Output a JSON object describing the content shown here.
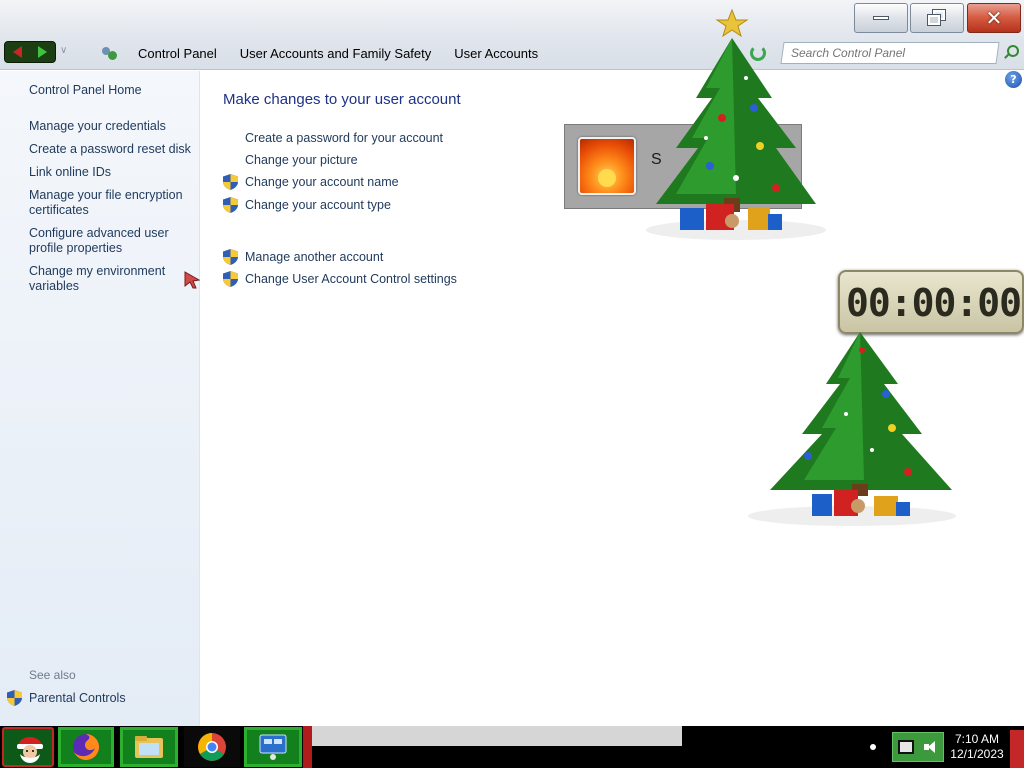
{
  "window": {
    "controls": {
      "minimize": "minimize",
      "maximize": "restore",
      "close": "close"
    }
  },
  "nav": {
    "breadcrumb": [
      "Control Panel",
      "User Accounts and Family Safety",
      "User Accounts"
    ],
    "search_placeholder": "Search Control Panel"
  },
  "sidebar": {
    "items": [
      "Control Panel Home",
      "Manage your credentials",
      "Create a password reset disk",
      "Link online IDs",
      "Manage your file encryption certificates",
      "Configure advanced user profile properties",
      "Change my environment variables"
    ],
    "see_also_label": "See also",
    "see_also_items": [
      "Parental Controls"
    ]
  },
  "main": {
    "title": "Make changes to your user account",
    "tasks": [
      {
        "label": "Create a password for your account",
        "shield": false
      },
      {
        "label": "Change your picture",
        "shield": false
      },
      {
        "label": "Change your account name",
        "shield": true
      },
      {
        "label": "Change your account type",
        "shield": true
      }
    ],
    "other_tasks": [
      {
        "label": "Manage another account",
        "shield": true
      },
      {
        "label": "Change User Account Control settings",
        "shield": true
      }
    ],
    "account_name_initial": "S"
  },
  "gadgets": {
    "clock_time": "00:00:00"
  },
  "taskbar": {
    "apps": [
      "start-santa",
      "firefox",
      "windows-explorer",
      "chrome",
      "remote-desktop"
    ],
    "time": "7:10 AM",
    "date": "12/1/2023"
  },
  "colors": {
    "link": "#1e395b",
    "title": "#1e3287",
    "sidebar_bg": "#e4ecf6",
    "close_button": "#d45a3f"
  }
}
